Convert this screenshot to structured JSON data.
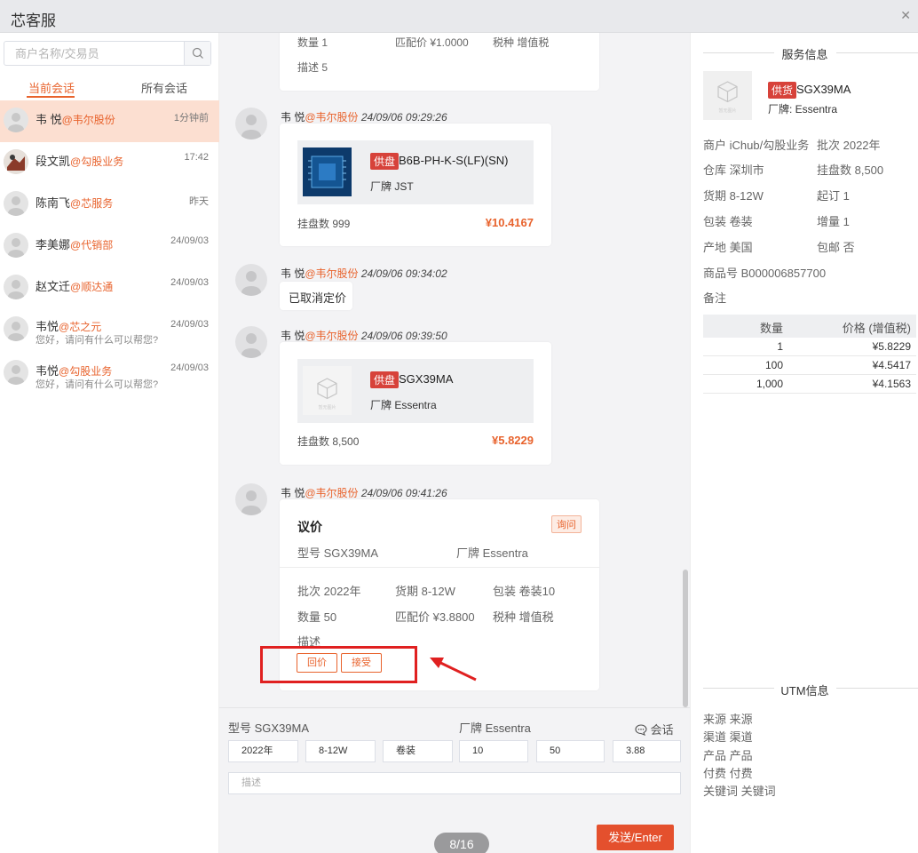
{
  "app": {
    "title": "芯客服",
    "close_icon": "✕"
  },
  "search": {
    "placeholder": "商户名称/交易员"
  },
  "tabs": [
    "当前会话",
    "所有会话"
  ],
  "conversations": [
    {
      "name": "韦 悦",
      "org": "@韦尔股份",
      "time": "1分钟前",
      "preview": ""
    },
    {
      "name": "段文凯",
      "org": "@勾股业务",
      "time": "17:42",
      "preview": ""
    },
    {
      "name": "陈南飞",
      "org": "@芯服务",
      "time": "昨天",
      "preview": ""
    },
    {
      "name": "李美娜",
      "org": "@代销部",
      "time": "24/09/03",
      "preview": ""
    },
    {
      "name": "赵文迁",
      "org": "@顺达通",
      "time": "24/09/03",
      "preview": ""
    },
    {
      "name": "韦悦",
      "org": "@芯之元",
      "time": "24/09/03",
      "preview": "您好，请问有什么可以帮您?"
    },
    {
      "name": "韦悦",
      "org": "@勾股业务",
      "time": "24/09/03",
      "preview": "您好，请问有什么可以帮您?"
    }
  ],
  "top_partial": {
    "qty": "数量 1",
    "match_price": "匹配价 ¥1.0000",
    "tax": "税种 增值税",
    "desc": "描述 5"
  },
  "messages": [
    {
      "sender": "韦 悦",
      "org": "@韦尔股份",
      "timestamp": "24/09/06 09:29:26",
      "tag": "供盘",
      "product": "B6B-PH-K-S(LF)(SN)",
      "brand": "厂牌 JST",
      "stock": "挂盘数 999",
      "price": "¥10.4167"
    },
    {
      "sender": "韦 悦",
      "org": "@韦尔股份",
      "timestamp": "24/09/06 09:34:02",
      "text": "已取消定价"
    },
    {
      "sender": "韦 悦",
      "org": "@韦尔股份",
      "timestamp": "24/09/06 09:39:50",
      "tag": "供盘",
      "product": "SGX39MA",
      "brand": "厂牌 Essentra",
      "stock": "挂盘数 8,500",
      "price": "¥5.8229"
    },
    {
      "sender": "韦 悦",
      "org": "@韦尔股份",
      "timestamp": "24/09/06 09:41:26",
      "negotiation": {
        "title": "议价",
        "badge": "询问",
        "model": "型号 SGX39MA",
        "brand": "厂牌 Essentra",
        "batch": "批次 2022年",
        "lead": "货期 8-12W",
        "pack": "包装 卷装10",
        "qty": "数量 50",
        "match_price": "匹配价 ¥3.8800",
        "tax": "税种 增值税",
        "desc": "描述",
        "counter_btn": "回价",
        "accept_btn": "接受"
      }
    }
  ],
  "placeholder_image_text": "暂无图片",
  "compose": {
    "model": "型号 SGX39MA",
    "brand": "厂牌 Essentra",
    "chat_label": "会话",
    "fields": [
      "2022年",
      "8-12W",
      "卷装",
      "10",
      "50",
      "3.88"
    ],
    "desc_placeholder": "描述",
    "send": "发送/Enter",
    "pager": "8/16"
  },
  "service_info": {
    "title": "服务信息",
    "tag": "供货",
    "product": "SGX39MA",
    "brand": "厂牌: Essentra",
    "merchant": "商户 iChub/勾股业务",
    "batch": "批次 2022年",
    "warehouse": "仓库 深圳市",
    "stock": "挂盘数 8,500",
    "lead": "货期 8-12W",
    "moq": "起订 1",
    "pack": "包装 卷装",
    "increment": "增量 1",
    "origin": "产地 美国",
    "free_ship": "包邮 否",
    "sku": "商品号 B000006857700",
    "remark": "备注",
    "price_table": {
      "headers": [
        "数量",
        "价格 (增值税)"
      ],
      "rows": [
        [
          "1",
          "¥5.8229"
        ],
        [
          "100",
          "¥4.5417"
        ],
        [
          "1,000",
          "¥4.1563"
        ]
      ]
    }
  },
  "utm": {
    "title": "UTM信息",
    "items": [
      "来源 来源",
      "渠道 渠道",
      "产品 产品",
      "付费 付费",
      "关键词 关键词"
    ]
  },
  "colors": {
    "accent": "#e8632d",
    "tag_red": "#d7423a",
    "annotation": "#e02020"
  }
}
